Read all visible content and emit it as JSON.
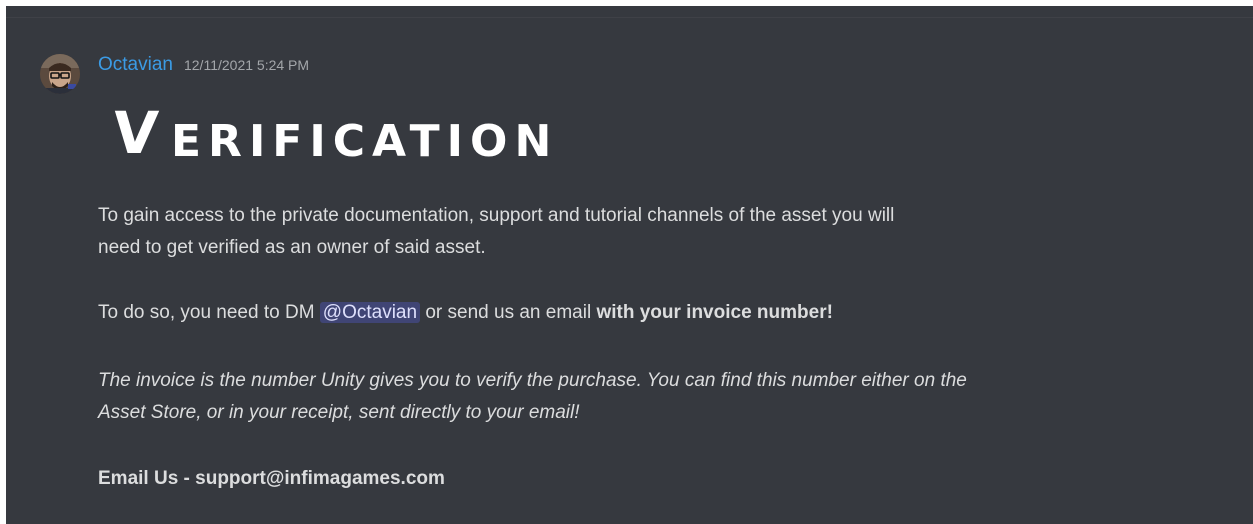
{
  "message": {
    "author": "Octavian",
    "timestamp": "12/11/2021 5:24 PM",
    "banner_text": "VERIFICATION",
    "banner_first": "V",
    "banner_rest": "ERIFICATION",
    "p1_line1": "To gain access to the private documentation, support and tutorial channels of the asset you will",
    "p1_line2": "need to get verified as an owner of said asset.",
    "p2_prefix": "To do so, you need to DM ",
    "p2_mention": "@Octavian",
    "p2_middle": " or send us an email ",
    "p2_bold": "with your invoice number!",
    "p3_line1": "The invoice is the number Unity gives you to verify the purchase. You can find this number either on the",
    "p3_line2": "Asset Store, or in your receipt, sent directly to your email!",
    "p4_bold": "Email Us - support@infimagames.com"
  },
  "colors": {
    "background": "#36393f",
    "username": "#3b9be5",
    "text": "#dcddde",
    "timestamp": "#a3a6aa",
    "mention_bg": "rgba(88,101,242,0.3)",
    "mention_text": "#dee0fc"
  },
  "icons": {
    "avatar": "user-avatar"
  }
}
